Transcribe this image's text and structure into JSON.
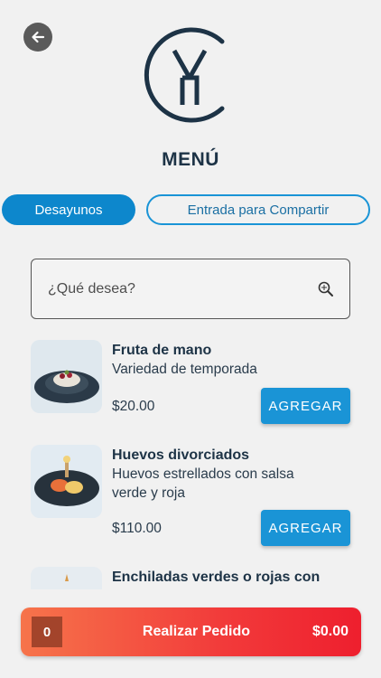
{
  "header": {
    "title": "MENÚ"
  },
  "tabs": [
    {
      "label": "Desayunos",
      "active": true
    },
    {
      "label": "Entrada para Compartir",
      "active": false
    }
  ],
  "search": {
    "placeholder": "¿Qué desea?"
  },
  "items": [
    {
      "name": "Fruta de mano",
      "description": "Variedad de temporada",
      "price": "$20.00",
      "button": "AGREGAR"
    },
    {
      "name": "Huevos divorciados",
      "description": "Huevos estrellados con salsa verde y roja",
      "price": "$110.00",
      "button": "AGREGAR"
    },
    {
      "name": "Enchiladas verdes o rojas con"
    }
  ],
  "order": {
    "count": "0",
    "label": "Realizar Pedido",
    "total": "$0.00"
  },
  "colors": {
    "accent": "#1a94d6",
    "navy": "#1d3346",
    "order_start": "#f6744b",
    "order_end": "#ee1f2e"
  }
}
